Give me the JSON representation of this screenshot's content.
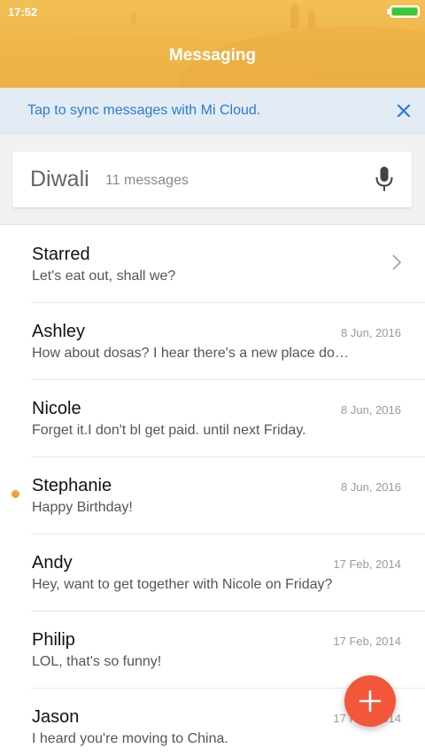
{
  "status_bar": {
    "time": "17:52"
  },
  "header": {
    "title": "Messaging"
  },
  "sync_banner": {
    "text": "Tap to sync messages with Mi Cloud.",
    "close_icon": "close-icon"
  },
  "search": {
    "query": "Diwali",
    "result_count": "11 messages",
    "mic_icon": "microphone-icon"
  },
  "conversations": [
    {
      "name": "Starred",
      "preview": "Let's eat out, shall we?",
      "date": ""
    },
    {
      "name": "Ashley",
      "preview": "How about dosas? I hear there's a new place down the street.",
      "date": "8 Jun, 2016"
    },
    {
      "name": "Nicole",
      "preview": "Forget it.I don't bl get paid. until next Friday.",
      "date": "8 Jun, 2016"
    },
    {
      "name": "Stephanie",
      "preview": "Happy Birthday!",
      "date": "8 Jun, 2016",
      "unread": true
    },
    {
      "name": "Andy",
      "preview": "Hey, want to get together with Nicole on Friday?",
      "date": "17 Feb, 2014"
    },
    {
      "name": "Philip",
      "preview": "LOL, that's so funny!",
      "date": "17 Feb, 2014"
    },
    {
      "name": "Jason",
      "preview": "I heard you're moving to China.",
      "date": "17 Feb, 2014"
    }
  ],
  "colors": {
    "accent": "#2a7dd1",
    "header": "#efb54a",
    "fab": "#f4563a",
    "unread_dot": "#f0a23a",
    "battery": "#2ecc40"
  },
  "fab": {
    "icon": "plus-icon"
  }
}
